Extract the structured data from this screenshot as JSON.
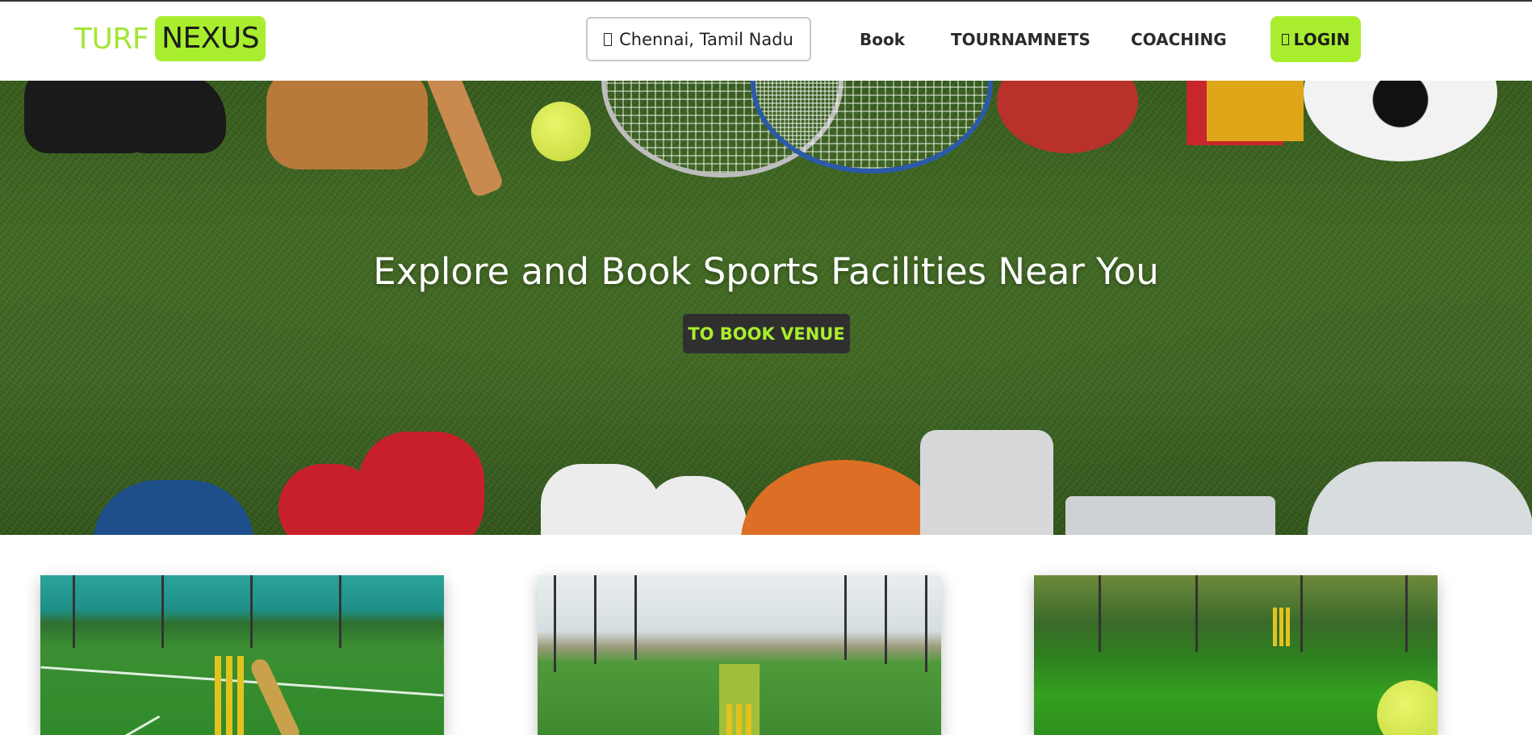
{
  "brand": {
    "part1": "TURF",
    "part2": "NEXUS"
  },
  "location": {
    "label": "Chennai, Tamil Nadu"
  },
  "nav": {
    "book": "Book",
    "tournaments": "TOURNAMNETS",
    "coaching": "COACHING",
    "login": "LOGIN"
  },
  "hero": {
    "title": "Explore and Book Sports Facilities Near You",
    "cta": "TO BOOK VENUE"
  },
  "venues": [
    {
      "name": "venue-card-1"
    },
    {
      "name": "venue-card-2"
    },
    {
      "name": "venue-card-3"
    }
  ],
  "colors": {
    "accent": "#a8ee2e",
    "dark": "#2f2f2f",
    "turf": "#4a762a"
  },
  "icons": {
    "location": "map-marker-icon",
    "login": "user-icon"
  }
}
